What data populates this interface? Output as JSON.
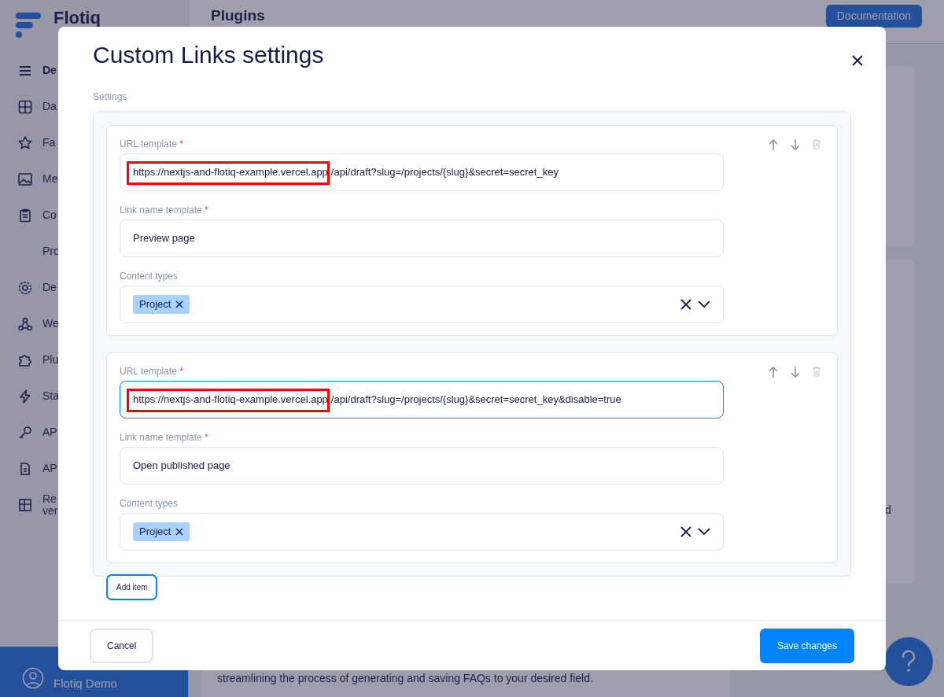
{
  "app": {
    "logo": "Flotiq",
    "page_title": "Plugins",
    "documentation_button": "Documentation",
    "sidebar": [
      {
        "kind": "menu",
        "label": "De",
        "bold": true
      },
      {
        "kind": "grid",
        "label": "Da",
        "bold": false
      },
      {
        "kind": "star",
        "label": "Fa",
        "bold": false
      },
      {
        "kind": "image",
        "label": "Me",
        "bold": false
      },
      {
        "kind": "clipboard",
        "label": "Co",
        "bold": false
      },
      {
        "kind": "sub",
        "label": "Pro",
        "bold": false
      },
      {
        "kind": "gear",
        "label": "De",
        "bold": false
      },
      {
        "kind": "nodes",
        "label": "We",
        "bold": false
      },
      {
        "kind": "puzzle",
        "label": "Plu",
        "bold": false
      },
      {
        "kind": "bolt",
        "label": "Sta",
        "bold": false
      },
      {
        "kind": "key",
        "label": "AP",
        "bold": false
      },
      {
        "kind": "docs",
        "label": "AP",
        "bold": false
      },
      {
        "kind": "layout",
        "label": "Re\nver",
        "bold": false
      }
    ],
    "user": "Flotiq Demo",
    "side_card_text": "d",
    "card_text": "streamlining the process of generating and saving FAQs to your desired field."
  },
  "modal": {
    "title": "Custom Links settings",
    "section_label": "Settings",
    "items": [
      {
        "url_label": "URL template",
        "url_required_mark": "*",
        "url_parts": [
          {
            "text": "https://nextjs-and-flotiq-example.vercel.app",
            "highlighted": true
          },
          {
            "text": "/api/draft?slug=/projects/{slug}&secret=secret_key",
            "highlighted": false
          }
        ],
        "url_focused": false,
        "name_label": "Link name template",
        "name_required_mark": "*",
        "name": "Preview page",
        "types_label": "Content types",
        "types": [
          "Project"
        ]
      },
      {
        "url_label": "URL template",
        "url_required_mark": "*",
        "url_parts": [
          {
            "text": "https://nextjs-and-flotiq-example.vercel.app",
            "highlighted": true
          },
          {
            "text": "/api/draft?slug=/projects/{slug}&secret=secret_key&disable=true",
            "highlighted": false
          }
        ],
        "url_focused": true,
        "name_label": "Link name template",
        "name_required_mark": "*",
        "name": "Open published page",
        "types_label": "Content types",
        "types": [
          "Project"
        ]
      }
    ],
    "add_button": "Add item",
    "cancel_button": "Cancel",
    "save_button": "Save changes"
  }
}
